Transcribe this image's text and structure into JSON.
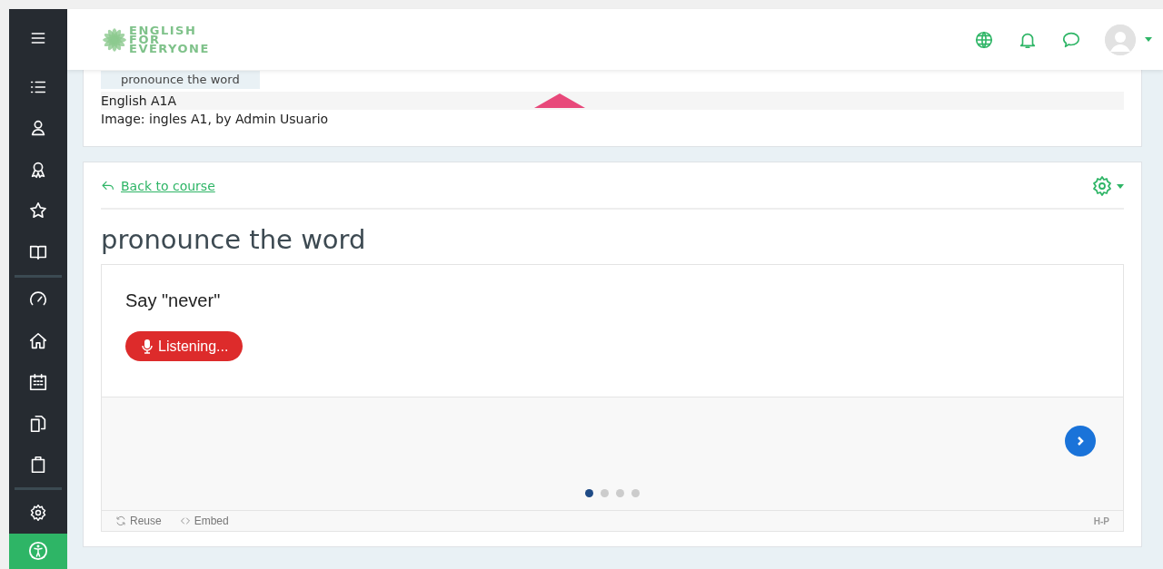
{
  "header": {
    "logo_lines": [
      "ENGLISH",
      "FOR",
      "EVERYONE"
    ]
  },
  "top_card": {
    "tag": "pronounce the word",
    "course": "English A1A",
    "image_credit": "Image: ingles A1, by Admin Usuario"
  },
  "activity": {
    "back_link": "Back to course",
    "title": "pronounce the word",
    "prompt": "Say \"never\"",
    "record_button": "Listening...",
    "dots": [
      {
        "selected": true
      },
      {
        "selected": false
      },
      {
        "selected": false
      },
      {
        "selected": false
      }
    ],
    "footer": {
      "links": [
        "Reuse",
        "Embed"
      ],
      "logo": "H-P"
    }
  }
}
